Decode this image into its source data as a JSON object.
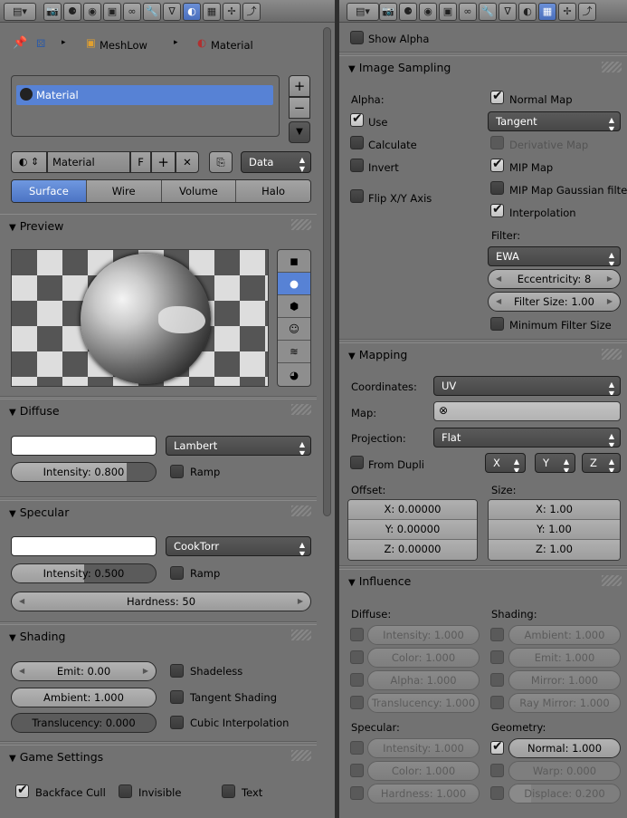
{
  "left": {
    "breadcrumb": {
      "mesh": "MeshLow",
      "material": "Material"
    },
    "material_list": [
      "Material"
    ],
    "datablock": {
      "name": "Material",
      "fake_user": "F",
      "link": "Data"
    },
    "tabs": [
      "Surface",
      "Wire",
      "Volume",
      "Halo"
    ],
    "panels": {
      "preview": "Preview",
      "diffuse": "Diffuse",
      "specular": "Specular",
      "shading": "Shading",
      "game": "Game Settings"
    },
    "diffuse": {
      "shader": "Lambert",
      "intensity": "Intensity: 0.800",
      "intensity_value": 0.8,
      "ramp": "Ramp",
      "color": "#ffffff"
    },
    "specular": {
      "shader": "CookTorr",
      "intensity": "Intensity: 0.500",
      "intensity_value": 0.5,
      "ramp": "Ramp",
      "hardness": "Hardness: 50",
      "color": "#ffffff"
    },
    "shading": {
      "emit": "Emit: 0.00",
      "ambient": "Ambient: 1.000",
      "translucency": "Translucency: 0.000",
      "shadeless": "Shadeless",
      "tangent": "Tangent Shading",
      "cubic": "Cubic Interpolation"
    },
    "game": {
      "backface": "Backface Cull",
      "invisible": "Invisible",
      "text": "Text"
    }
  },
  "right": {
    "show_alpha": "Show Alpha",
    "panels": {
      "sampling": "Image Sampling",
      "mapping": "Mapping",
      "influence": "Influence"
    },
    "sampling": {
      "alpha_label": "Alpha:",
      "use": "Use",
      "calculate": "Calculate",
      "invert": "Invert",
      "flip": "Flip X/Y Axis",
      "normal_map": "Normal Map",
      "space": "Tangent",
      "derivative": "Derivative Map",
      "mip": "MIP Map",
      "mip_gauss": "MIP Map Gaussian filter",
      "interp": "Interpolation",
      "filter_label": "Filter:",
      "filter": "EWA",
      "eccentricity": "Eccentricity: 8",
      "filter_size": "Filter Size: 1.00",
      "min_filter": "Minimum Filter Size"
    },
    "mapping": {
      "coords_label": "Coordinates:",
      "coords": "UV",
      "map_label": "Map:",
      "proj_label": "Projection:",
      "proj": "Flat",
      "from_dupli": "From Dupli",
      "x": "X",
      "y": "Y",
      "z": "Z",
      "offset_label": "Offset:",
      "size_label": "Size:",
      "offset": [
        "X: 0.00000",
        "Y: 0.00000",
        "Z: 0.00000"
      ],
      "size": [
        "X: 1.00",
        "Y: 1.00",
        "Z: 1.00"
      ]
    },
    "influence": {
      "diffuse_label": "Diffuse:",
      "shading_label": "Shading:",
      "specular_label": "Specular:",
      "geometry_label": "Geometry:",
      "diffuse": [
        "Intensity: 1.000",
        "Color: 1.000",
        "Alpha: 1.000",
        "Translucency: 1.000"
      ],
      "shading": [
        "Ambient: 1.000",
        "Emit: 1.000",
        "Mirror: 1.000",
        "Ray Mirror: 1.000"
      ],
      "specular": [
        "Intensity: 1.000",
        "Color: 1.000",
        "Hardness: 1.000"
      ],
      "geometry": [
        "Normal: 1.000",
        "Warp: 0.000",
        "Displace: 0.200"
      ]
    }
  }
}
